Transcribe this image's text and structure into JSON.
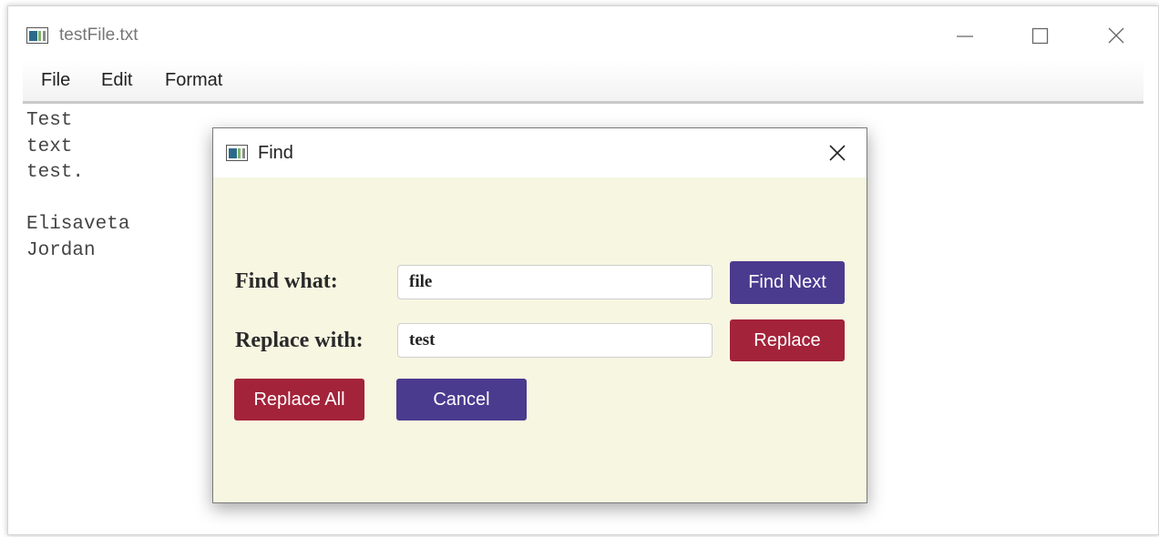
{
  "window": {
    "title": "testFile.txt"
  },
  "menu": {
    "items": [
      "File",
      "Edit",
      "Format"
    ]
  },
  "editor": {
    "content": "Test\ntext\ntest.\n\nElisaveta\nJordan"
  },
  "find_dialog": {
    "title": "Find",
    "find_label": "Find what:",
    "find_value": "file",
    "replace_label": "Replace with:",
    "replace_value": "test",
    "buttons": {
      "find_next": "Find Next",
      "replace": "Replace",
      "replace_all": "Replace All",
      "cancel": "Cancel"
    }
  },
  "colors": {
    "dialog_background": "#f7f6e1",
    "purple_button": "#4a3b8f",
    "red_button": "#a3233a"
  }
}
